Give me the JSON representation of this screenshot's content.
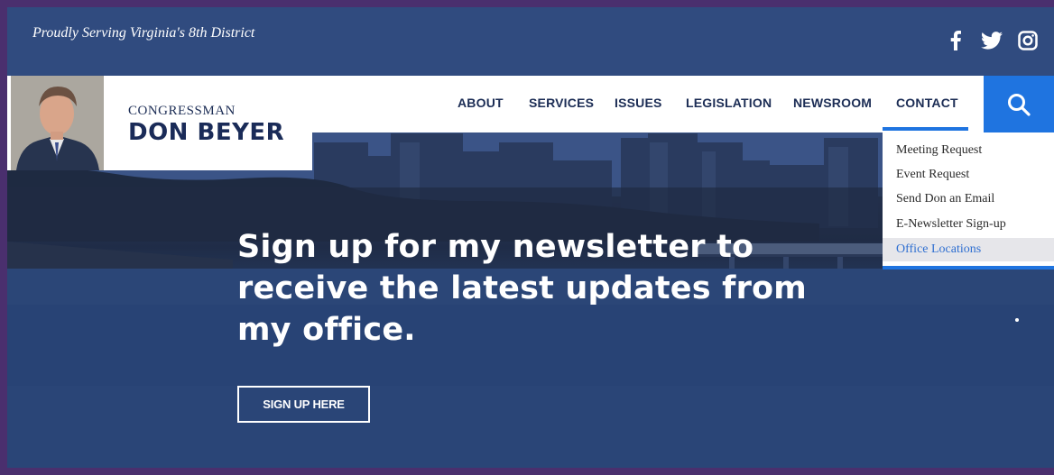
{
  "header": {
    "tagline": "Proudly Serving Virginia's 8th District",
    "social": [
      {
        "icon": "facebook-icon"
      },
      {
        "icon": "twitter-icon"
      },
      {
        "icon": "instagram-icon"
      }
    ]
  },
  "brand": {
    "title_small": "CONGRESSMAN",
    "title_big": "DON BEYER"
  },
  "nav": {
    "items": [
      {
        "label": "ABOUT"
      },
      {
        "label": "SERVICES"
      },
      {
        "label": "ISSUES"
      },
      {
        "label": "LEGISLATION"
      },
      {
        "label": "NEWSROOM"
      },
      {
        "label": "CONTACT"
      }
    ],
    "search_icon": "search-icon"
  },
  "dropdown": {
    "items": [
      {
        "label": "Meeting Request"
      },
      {
        "label": "Event Request"
      },
      {
        "label": "Send Don an Email"
      },
      {
        "label": "E-Newsletter Sign-up"
      },
      {
        "label": "Office Locations"
      }
    ]
  },
  "hero": {
    "headline": "Sign up for my newsletter to receive the latest updates from my office.",
    "cta_label": "SIGN UP HERE"
  },
  "colors": {
    "accent": "#1f74e0",
    "navy": "#1c2d55",
    "frame": "#4a2f6e"
  }
}
